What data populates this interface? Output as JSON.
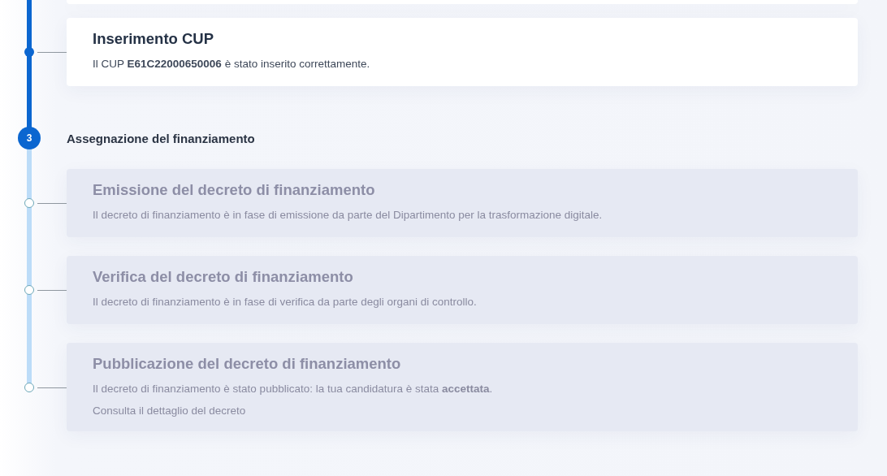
{
  "steps": [
    {
      "active": true,
      "cut_off_top": true,
      "items": [
        {
          "title": "Inserimento CUP",
          "description": "Il CUP **E61C22000650006** è stato inserito correttamente.",
          "completed": true
        }
      ]
    },
    {
      "number": "3",
      "label": "Assegnazione del finanziamento",
      "active": true,
      "items": [
        {
          "title": "Emissione del decreto di finanziamento",
          "description": "Il decreto di finanziamento è in fase di emissione da parte del Dipartimento per la trasformazione digitale.",
          "completed": false
        },
        {
          "title": "Verifica del decreto di finanziamento",
          "description": "Il decreto di finanziamento è in fase di verifica da parte degli organi di controllo.",
          "completed": false
        },
        {
          "title": "Pubblicazione del decreto di finanziamento",
          "description": "Il decreto di finanziamento è stato pubblicato: la tua candidatura è stata **accettata**.",
          "note": "Consulta il dettaglio del decreto",
          "completed": false
        }
      ]
    }
  ]
}
